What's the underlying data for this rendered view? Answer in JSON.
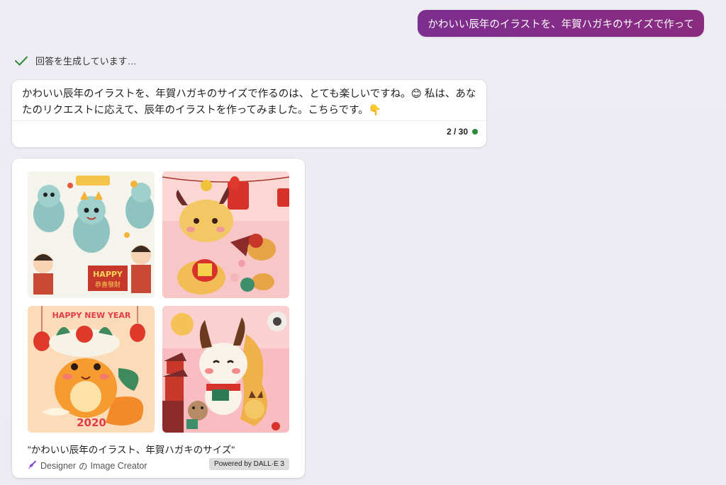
{
  "user_message": "かわいい辰年のイラストを、年賀ハガキのサイズで作って",
  "status": {
    "text": "回答を生成しています…",
    "icon": "checkmark-icon",
    "color": "#2e8b3a"
  },
  "reply": {
    "text": "かわいい辰年のイラストを、年賀ハガキのサイズで作るのは、とても楽しいですね。😊 私は、あなたのリクエストに応えて、辰年のイラストを作ってみました。こちらです。👇",
    "counter": "2 / 30",
    "counter_dot_color": "#2e8b3a"
  },
  "images": {
    "items": [
      {
        "name": "dragon-sticker-sheet",
        "banner": "HAPPY",
        "sign": "恭喜發財"
      },
      {
        "name": "dragon-with-lanterns"
      },
      {
        "name": "dragon-happy-new-year",
        "title": "HAPPY NEW YEAR",
        "year": "2020"
      },
      {
        "name": "dragon-with-pagoda"
      }
    ],
    "caption": "\"かわいい辰年のイラスト、年賀ハガキのサイズ\"",
    "credit_icon": "designer-brush-icon",
    "credit_designer": "Designer",
    "credit_separator": "の",
    "credit_product": "Image Creator",
    "powered_by": "Powered by DALL·E 3"
  },
  "colors": {
    "user_bubble": "#7d2f8f",
    "background": "#eeedf3",
    "accent_green": "#2e8b3a"
  }
}
